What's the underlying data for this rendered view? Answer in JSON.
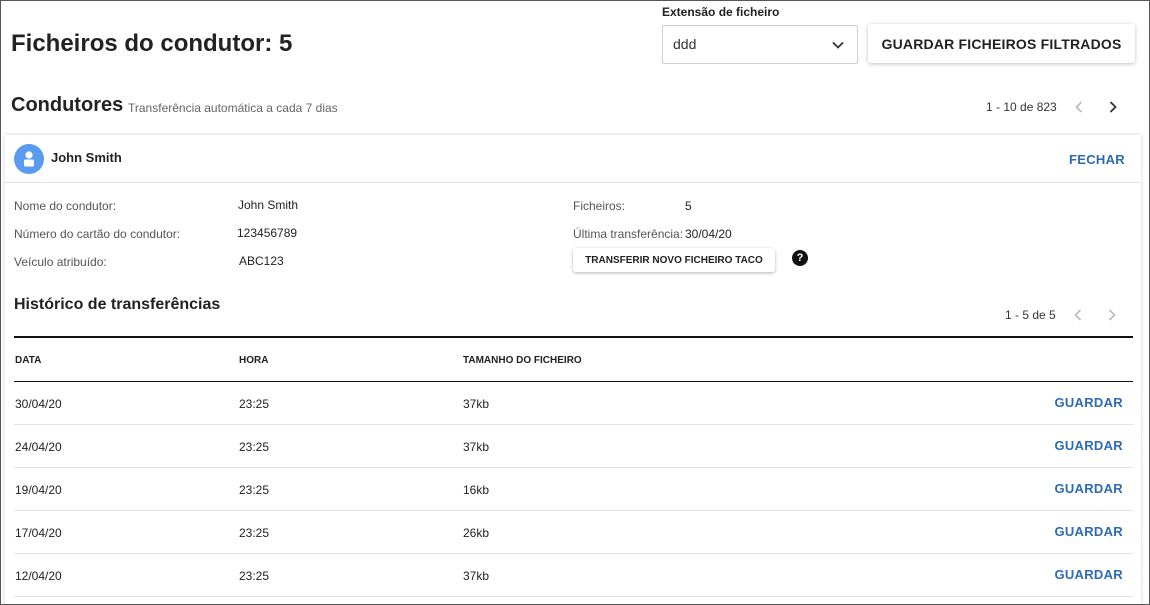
{
  "header": {
    "title": "Ficheiros do condutor: 5",
    "file_extension_label": "Extensão de ficheiro",
    "file_extension_value": "ddd",
    "save_filtered_label": "GUARDAR FICHEIROS FILTRADOS"
  },
  "drivers_section": {
    "title": "Condutores",
    "subtitle": "Transferência automática a cada 7 dias",
    "pagination": "1 - 10 de 823"
  },
  "driver_card": {
    "name": "John Smith",
    "close_label": "FECHAR",
    "fields": {
      "driver_name_label": "Nome do condutor:",
      "driver_name_value": "John Smith",
      "card_number_label": "Número do cartão do condutor:",
      "card_number_value": "123456789",
      "vehicle_label": "Veículo atribuído:",
      "vehicle_value": "ABC123",
      "files_label": "Ficheiros:",
      "files_value": "5",
      "last_transfer_label": "Última transferência:",
      "last_transfer_value": "30/04/20"
    },
    "transfer_button_label": "TRANSFERIR NOVO FICHEIRO TACO",
    "help_icon": "?"
  },
  "history": {
    "title": "Histórico de transferências",
    "pagination": "1 - 5 de 5",
    "columns": [
      "DATA",
      "HORA",
      "TAMANHO DO FICHEIRO"
    ],
    "rows": [
      {
        "date": "30/04/20",
        "time": "23:25",
        "size": "37kb",
        "action": "GUARDAR"
      },
      {
        "date": "24/04/20",
        "time": "23:25",
        "size": "37kb",
        "action": "GUARDAR"
      },
      {
        "date": "19/04/20",
        "time": "23:25",
        "size": "16kb",
        "action": "GUARDAR"
      },
      {
        "date": "17/04/20",
        "time": "23:25",
        "size": "26kb",
        "action": "GUARDAR"
      },
      {
        "date": "12/04/20",
        "time": "23:25",
        "size": "37kb",
        "action": "GUARDAR"
      }
    ]
  },
  "colors": {
    "accent_link": "#2d6bb5",
    "avatar": "#5b9bef"
  },
  "icons": {
    "select_chevron": "chevron-down-icon",
    "prev": "chevron-left-icon",
    "next": "chevron-right-icon",
    "avatar": "person-icon",
    "help": "help-icon"
  }
}
